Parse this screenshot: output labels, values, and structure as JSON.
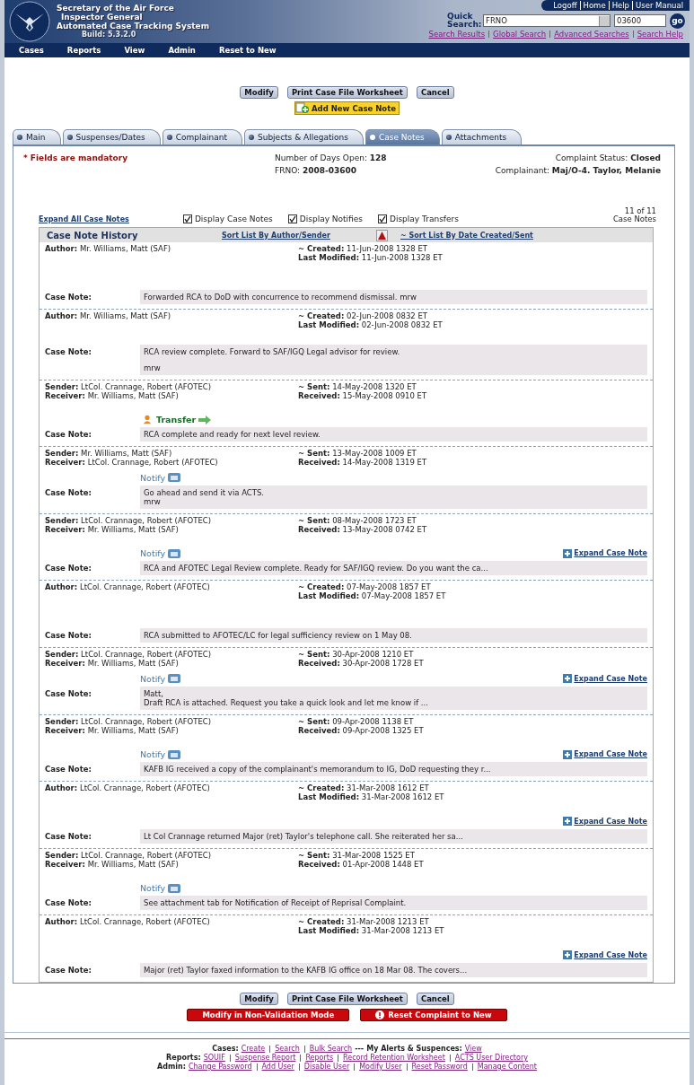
{
  "header": {
    "title_lines": [
      "Secretary of the Air Force",
      "Inspector General",
      "Automated Case Tracking System"
    ],
    "build": "Build: 5.3.2.0",
    "top_links": [
      "Logoff",
      "Home",
      "Help",
      "User Manual"
    ],
    "quick_search": {
      "label": "Quick Search:",
      "field": "FRNO",
      "value": "03600",
      "go": "go"
    },
    "search_links": [
      "Search Results",
      "Global Search",
      "Advanced Searches",
      "Search Help"
    ]
  },
  "menu": [
    "Cases",
    "Reports",
    "View",
    "Admin",
    "Reset to New"
  ],
  "top_buttons": [
    "Modify",
    "Print Case File Worksheet",
    "Cancel"
  ],
  "add_note": "Add New Case Note",
  "tabs": [
    {
      "label": "Main",
      "selected": false
    },
    {
      "label": "Suspenses/Dates",
      "selected": false
    },
    {
      "label": "Complainant",
      "selected": false
    },
    {
      "label": "Subjects & Allegations",
      "selected": false
    },
    {
      "label": "Case Notes",
      "selected": true
    },
    {
      "label": "Attachments",
      "selected": false
    }
  ],
  "mandatory": "* Fields are mandatory",
  "summary": {
    "days_label": "Number of Days Open:",
    "days": "128",
    "frno_label": "FRNO:",
    "frno": "2008-03600",
    "status_label": "Complaint Status:",
    "status": "Closed",
    "complainant_label": "Complainant:",
    "complainant": "Maj/O-4. Taylor, Melanie"
  },
  "expand_all": "Expand All Case Notes",
  "filters": [
    {
      "label": "Display Case Notes",
      "checked": true
    },
    {
      "label": "Display Notifies",
      "checked": true
    },
    {
      "label": "Display Transfers",
      "checked": true
    }
  ],
  "count": [
    "11 of 11",
    "Case Notes"
  ],
  "history": {
    "title": "Case Note History",
    "sort_author": "Sort List By Author/Sender",
    "sort_date": "~ Sort List By Date Created/Sent",
    "entries": [
      {
        "left": [
          [
            "Author:",
            "Mr. Williams, Matt (SAF)"
          ]
        ],
        "right": [
          [
            "~ Created:",
            "11-Jun-2008 1328 ET"
          ],
          [
            "Last Modified:",
            "11-Jun-2008 1328 ET"
          ]
        ],
        "note_label": "Case Note:",
        "note": [
          [
            "Forwarded RCA to DoD with concurrence to recommend dismissal. mrw"
          ]
        ]
      },
      {
        "left": [
          [
            "Author:",
            "Mr. Williams, Matt (SAF)"
          ]
        ],
        "right": [
          [
            "~ Created:",
            "02-Jun-2008 0832 ET"
          ],
          [
            "Last Modified:",
            "02-Jun-2008 0832 ET"
          ]
        ],
        "note_label": "Case Note:",
        "note": [
          [
            "RCA review complete. Forward to SAF/IGQ Legal advisor for review."
          ],
          [
            "mrw"
          ]
        ]
      },
      {
        "left": [
          [
            "Sender:",
            "LtCol. Crannage, Robert (AFOTEC)"
          ],
          [
            "Receiver:",
            "Mr. Williams, Matt (SAF)"
          ]
        ],
        "right": [
          [
            "~ Sent:",
            "14-May-2008 1320 ET"
          ],
          [
            "Received:",
            "15-May-2008 0910 ET"
          ]
        ],
        "marker": {
          "kind": "transfer",
          "label": "Transfer"
        },
        "note_label": "Case Note:",
        "note": [
          [
            "RCA complete and ready for next level review."
          ]
        ]
      },
      {
        "left": [
          [
            "Sender:",
            "Mr. Williams, Matt (SAF)"
          ],
          [
            "Receiver:",
            "LtCol. Crannage, Robert (AFOTEC)"
          ]
        ],
        "right": [
          [
            "~ Sent:",
            "13-May-2008 1009 ET"
          ],
          [
            "Received:",
            "14-May-2008 1319 ET"
          ]
        ],
        "marker": {
          "kind": "notify",
          "label": "Notify"
        },
        "note_label": "Case Note:",
        "note": [
          [
            "Go ahead and send it via ACTS.",
            "mrw"
          ]
        ]
      },
      {
        "left": [
          [
            "Sender:",
            "LtCol. Crannage, Robert (AFOTEC)"
          ],
          [
            "Receiver:",
            "Mr. Williams, Matt (SAF)"
          ]
        ],
        "right": [
          [
            "~ Sent:",
            "08-May-2008 1723 ET"
          ],
          [
            "Received:",
            "13-May-2008 0742 ET"
          ]
        ],
        "marker": {
          "kind": "notify",
          "label": "Notify"
        },
        "expand": "Expand Case Note",
        "note_label": "Case Note:",
        "note": [
          [
            "RCA and AFOTEC Legal Review complete. Ready for SAF/IGQ review. Do you want the ca..."
          ]
        ]
      },
      {
        "left": [
          [
            "Author:",
            "LtCol. Crannage, Robert (AFOTEC)"
          ]
        ],
        "right": [
          [
            "~ Created:",
            "07-May-2008 1857 ET"
          ],
          [
            "Last Modified:",
            "07-May-2008 1857 ET"
          ]
        ],
        "note_label": "Case Note:",
        "note": [
          [
            "RCA submitted to AFOTEC/LC for legal sufficiency review on 1 May 08."
          ]
        ]
      },
      {
        "left": [
          [
            "Sender:",
            "LtCol. Crannage, Robert (AFOTEC)"
          ],
          [
            "Receiver:",
            "Mr. Williams, Matt (SAF)"
          ]
        ],
        "right": [
          [
            "~ Sent:",
            "30-Apr-2008 1210 ET"
          ],
          [
            "Received:",
            "30-Apr-2008 1728 ET"
          ]
        ],
        "marker": {
          "kind": "notify",
          "label": "Notify"
        },
        "expand": "Expand Case Note",
        "note_label": "Case Note:",
        "note": [
          [
            "Matt,",
            "Draft RCA is attached. Request you take a quick look and let me know if ..."
          ]
        ]
      },
      {
        "left": [
          [
            "Sender:",
            "LtCol. Crannage, Robert (AFOTEC)"
          ],
          [
            "Receiver:",
            "Mr. Williams, Matt (SAF)"
          ]
        ],
        "right": [
          [
            "~ Sent:",
            "09-Apr-2008 1138 ET"
          ],
          [
            "Received:",
            "09-Apr-2008 1325 ET"
          ]
        ],
        "marker": {
          "kind": "notify",
          "label": "Notify"
        },
        "expand": "Expand Case Note",
        "note_label": "Case Note:",
        "note": [
          [
            "KAFB IG received a copy of the complainant's memorandum to IG, DoD requesting they r..."
          ]
        ]
      },
      {
        "left": [
          [
            "Author:",
            "LtCol. Crannage, Robert (AFOTEC)"
          ]
        ],
        "right": [
          [
            "~ Created:",
            "31-Mar-2008 1612 ET"
          ],
          [
            "Last Modified:",
            "31-Mar-2008 1612 ET"
          ]
        ],
        "expand": "Expand Case Note",
        "note_label": "Case Note:",
        "note": [
          [
            "Lt Col Crannage returned Major (ret) Taylor's telephone call. She reiterated her sa..."
          ]
        ]
      },
      {
        "left": [
          [
            "Sender:",
            "LtCol. Crannage, Robert (AFOTEC)"
          ],
          [
            "Receiver:",
            "Mr. Williams, Matt (SAF)"
          ]
        ],
        "right": [
          [
            "~ Sent:",
            "31-Mar-2008 1525 ET"
          ],
          [
            "Received:",
            "01-Apr-2008 1448 ET"
          ]
        ],
        "marker": {
          "kind": "notify",
          "label": "Notify"
        },
        "note_label": "Case Note:",
        "note": [
          [
            "See attachment tab for Notification of Receipt of Reprisal Complaint."
          ]
        ]
      },
      {
        "left": [
          [
            "Author:",
            "LtCol. Crannage, Robert (AFOTEC)"
          ]
        ],
        "right": [
          [
            "~ Created:",
            "31-Mar-2008 1213 ET"
          ],
          [
            "Last Modified:",
            "31-Mar-2008 1213 ET"
          ]
        ],
        "expand": "Expand Case Note",
        "note_label": "Case Note:",
        "note": [
          [
            "Major (ret) Taylor faxed information to the KAFB IG office on 18 Mar 08. The covers..."
          ]
        ]
      }
    ]
  },
  "bottom_buttons": [
    "Modify",
    "Print Case File Worksheet",
    "Cancel"
  ],
  "red_buttons": [
    {
      "kind": "plain",
      "label": "Modify in Non-Validation Mode"
    },
    {
      "kind": "alert",
      "label": "Reset Complaint to New"
    }
  ],
  "footer": [
    [
      {
        "label": "Cases:",
        "links": [
          "Create",
          "Search",
          "Bulk Search"
        ]
      },
      {
        "prefix": "---",
        "label": "My Alerts & Suspences:",
        "links": [
          "View"
        ]
      }
    ],
    [
      {
        "label": "Reports:",
        "links": [
          "SOUIF",
          "Suspense Report",
          "Reports",
          "Record Retention Worksheet",
          "ACTS User Directory"
        ]
      }
    ],
    [
      {
        "label": "Admin:",
        "links": [
          "Change Password",
          "Add User",
          "Disable User",
          "Modify User",
          "Reset Password",
          "Manage Content"
        ]
      }
    ]
  ]
}
